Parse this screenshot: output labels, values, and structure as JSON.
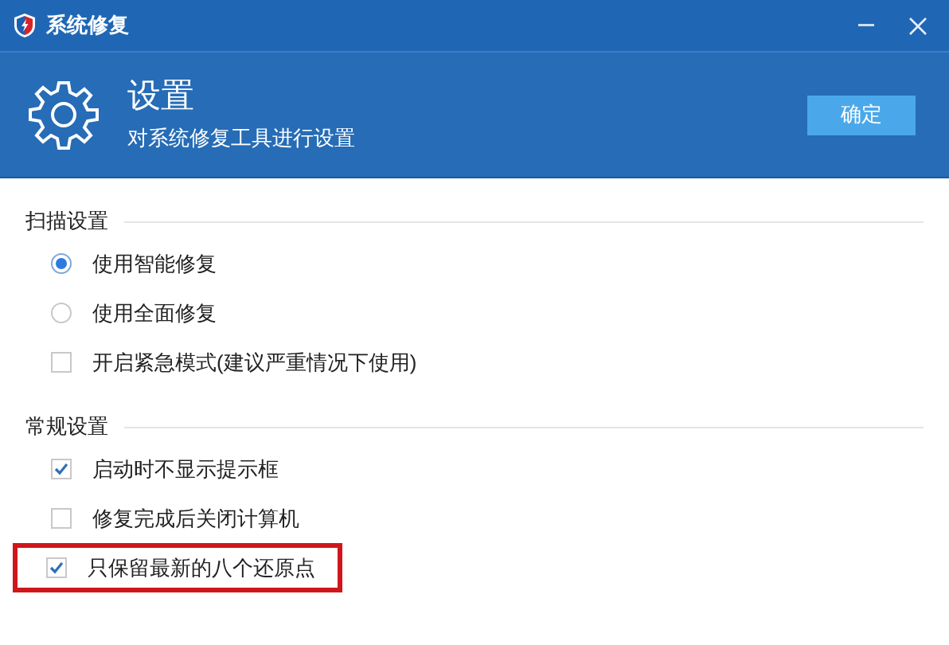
{
  "window": {
    "title": "系统修复"
  },
  "header": {
    "title": "设置",
    "subtitle": "对系统修复工具进行设置",
    "confirm_button": "确定"
  },
  "sections": [
    {
      "title": "扫描设置",
      "options": [
        {
          "kind": "radio",
          "label": "使用智能修复",
          "selected": true,
          "highlighted": false
        },
        {
          "kind": "radio",
          "label": "使用全面修复",
          "selected": false,
          "highlighted": false
        },
        {
          "kind": "checkbox",
          "label": "开启紧急模式(建议严重情况下使用)",
          "checked": false,
          "highlighted": false
        }
      ]
    },
    {
      "title": "常规设置",
      "options": [
        {
          "kind": "checkbox",
          "label": "启动时不显示提示框",
          "checked": true,
          "highlighted": false
        },
        {
          "kind": "checkbox",
          "label": "修复完成后关闭计算机",
          "checked": false,
          "highlighted": false
        },
        {
          "kind": "checkbox",
          "label": "只保留最新的八个还原点",
          "checked": true,
          "highlighted": true
        }
      ]
    }
  ]
}
